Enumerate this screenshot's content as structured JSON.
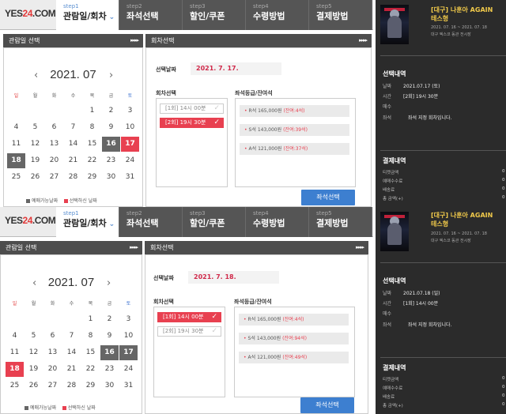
{
  "screens": [
    {
      "logo": {
        "a": "YES",
        "b": "24",
        "c": ".COM"
      },
      "steps": [
        {
          "num": "step1",
          "label": "관람일/회차",
          "chev": "⌄"
        },
        {
          "num": "step2",
          "label": "좌석선택"
        },
        {
          "num": "step3",
          "label": "할인/쿠폰"
        },
        {
          "num": "step4",
          "label": "수령방법"
        },
        {
          "num": "step5",
          "label": "결제방법"
        }
      ],
      "left_header": "관람일 선택",
      "right_header": "회차선택",
      "header_arrows": "▸▸▸▸",
      "calendar": {
        "prev": "‹",
        "next": "›",
        "month": "2021. 07",
        "weekdays": [
          "일",
          "월",
          "화",
          "수",
          "목",
          "금",
          "토"
        ],
        "rows": [
          [
            "",
            "",
            "",
            "",
            "1",
            "2",
            "3"
          ],
          [
            "4",
            "5",
            "6",
            "7",
            "8",
            "9",
            "10"
          ],
          [
            "11",
            "12",
            "13",
            "14",
            "15",
            "16",
            "17"
          ],
          [
            "18",
            "19",
            "20",
            "21",
            "22",
            "23",
            "24"
          ],
          [
            "25",
            "26",
            "27",
            "28",
            "29",
            "30",
            "31"
          ]
        ],
        "available": [
          "16",
          "17",
          "18"
        ],
        "selected": "17"
      },
      "legend": {
        "available": "예매가능날짜",
        "selected": "선택하신 날짜"
      },
      "selected_date_label": "선택날짜",
      "selected_date_value": "2021. 7. 17.",
      "session_label": "회차선택",
      "sessions": [
        {
          "label": "[1회] 14시 00분",
          "on": false,
          "check": "✓"
        },
        {
          "label": "[2회] 19시 30분",
          "on": true,
          "check": "✓"
        }
      ],
      "seat_label": "좌석등급/잔여석",
      "seats": [
        {
          "grade": "R석",
          "price": "165,000원",
          "remain": "(잔여:4석)"
        },
        {
          "grade": "S석",
          "price": "143,000원",
          "remain": "(잔여:39석)"
        },
        {
          "grade": "A석",
          "price": "121,000원",
          "remain": "(잔여:37석)"
        }
      ],
      "select_button": "좌석선택",
      "movie": {
        "title_line1": "[대구] 나훈아 AGAIN",
        "title_line2": "테스형",
        "period": "2021. 07. 16 ~ 2021. 07. 18",
        "venue": "대구 엑스코 동관 전시장"
      },
      "summary": {
        "title": "선택내역",
        "rows": [
          {
            "k": "날짜",
            "v": "2021.07.17 (토)"
          },
          {
            "k": "시간",
            "v": "[2회] 19시 30분"
          },
          {
            "k": "매수",
            "v": ""
          },
          {
            "k": "좌석",
            "v": "좌석 지정 회차입니다."
          }
        ]
      },
      "payment": {
        "title": "결제내역",
        "rows": [
          {
            "k": "티켓금액",
            "v": "0"
          },
          {
            "k": "예매수수료",
            "v": "0"
          },
          {
            "k": "배송료",
            "v": "0"
          },
          {
            "k": "총 금액(+)",
            "v": "0"
          }
        ]
      }
    },
    {
      "logo": {
        "a": "YES",
        "b": "24",
        "c": ".COM"
      },
      "steps": [
        {
          "num": "step1",
          "label": "관람일/회차",
          "chev": "⌄"
        },
        {
          "num": "step2",
          "label": "좌석선택"
        },
        {
          "num": "step3",
          "label": "할인/쿠폰"
        },
        {
          "num": "step4",
          "label": "수령방법"
        },
        {
          "num": "step5",
          "label": "결제방법"
        }
      ],
      "left_header": "관람일 선택",
      "right_header": "회차선택",
      "header_arrows": "▸▸▸▸",
      "calendar": {
        "prev": "‹",
        "next": "›",
        "month": "2021. 07",
        "weekdays": [
          "일",
          "월",
          "화",
          "수",
          "목",
          "금",
          "토"
        ],
        "rows": [
          [
            "",
            "",
            "",
            "",
            "1",
            "2",
            "3"
          ],
          [
            "4",
            "5",
            "6",
            "7",
            "8",
            "9",
            "10"
          ],
          [
            "11",
            "12",
            "13",
            "14",
            "15",
            "16",
            "17"
          ],
          [
            "18",
            "19",
            "20",
            "21",
            "22",
            "23",
            "24"
          ],
          [
            "25",
            "26",
            "27",
            "28",
            "29",
            "30",
            "31"
          ]
        ],
        "available": [
          "16",
          "17",
          "18"
        ],
        "selected": "18"
      },
      "legend": {
        "available": "예매가능날짜",
        "selected": "선택하신 날짜"
      },
      "selected_date_label": "선택날짜",
      "selected_date_value": "2021. 7. 18.",
      "session_label": "회차선택",
      "sessions": [
        {
          "label": "[1회] 14시 00분",
          "on": true,
          "check": "✓"
        },
        {
          "label": "[2회] 19시 30분",
          "on": false,
          "check": "✓"
        }
      ],
      "seat_label": "좌석등급/잔여석",
      "seats": [
        {
          "grade": "R석",
          "price": "165,000원",
          "remain": "(잔여:4석)"
        },
        {
          "grade": "S석",
          "price": "143,000원",
          "remain": "(잔여:94석)"
        },
        {
          "grade": "A석",
          "price": "121,000원",
          "remain": "(잔여:49석)"
        }
      ],
      "select_button": "좌석선택",
      "movie": {
        "title_line1": "[대구] 나훈아 AGAIN",
        "title_line2": "테스형",
        "period": "2021. 07. 16 ~ 2021. 07. 18",
        "venue": "대구 엑스코 동관 전시장"
      },
      "summary": {
        "title": "선택내역",
        "rows": [
          {
            "k": "날짜",
            "v": "2021.07.18 (일)"
          },
          {
            "k": "시간",
            "v": "[1회] 14시 00분"
          },
          {
            "k": "매수",
            "v": ""
          },
          {
            "k": "좌석",
            "v": "좌석 지정 회차입니다."
          }
        ]
      },
      "payment": {
        "title": "결제내역",
        "rows": [
          {
            "k": "티켓금액",
            "v": "0"
          },
          {
            "k": "예매수수료",
            "v": "0"
          },
          {
            "k": "배송료",
            "v": "0"
          },
          {
            "k": "총 금액(+)",
            "v": "0"
          }
        ]
      }
    }
  ]
}
